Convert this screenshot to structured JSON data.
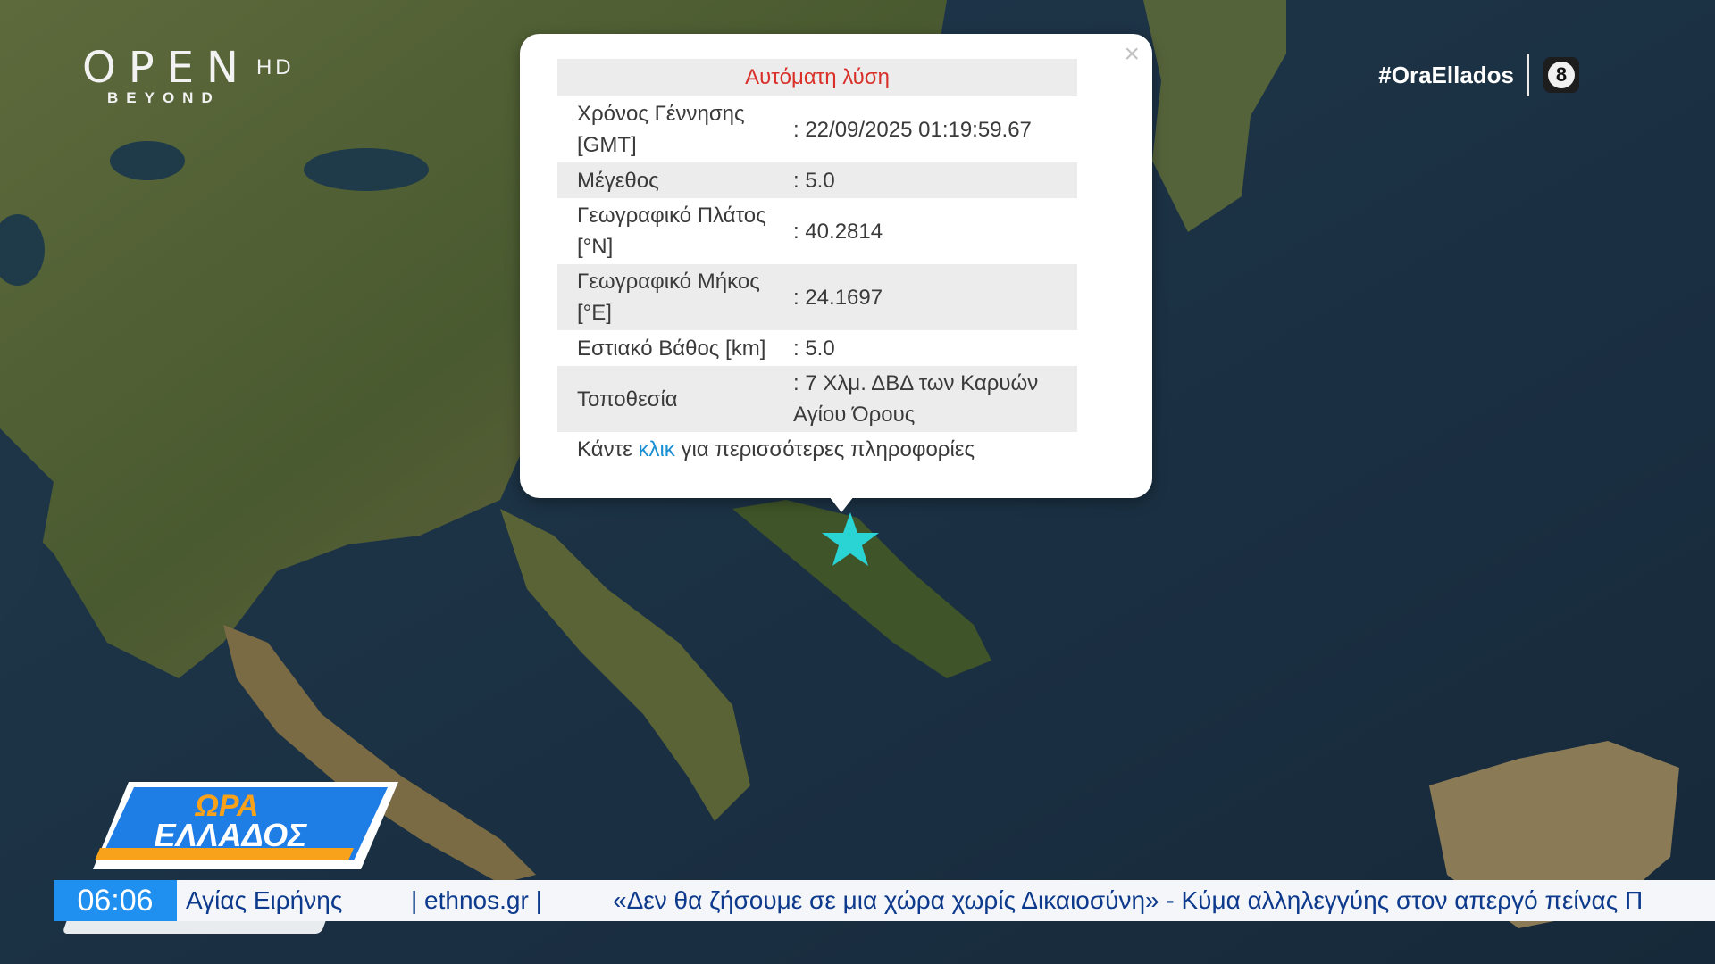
{
  "channel": {
    "name": "OPEN",
    "quality": "HD",
    "tagline": "BEYOND"
  },
  "hashtag": "#OraEllados",
  "rating": "8",
  "popup": {
    "title": "Αυτόματη λύση",
    "close_label": "×",
    "rows": [
      {
        "label": "Χρόνος Γέννησης [GMT]",
        "value": ": 22/09/2025 01:19:59.67"
      },
      {
        "label": "Μέγεθος",
        "value": ": 5.0"
      },
      {
        "label": "Γεωγραφικό Πλάτος [°N]",
        "value": ": 40.2814"
      },
      {
        "label": "Γεωγραφικό Μήκος [°E]",
        "value": ": 24.1697"
      },
      {
        "label": "Εστιακό Βάθος [km]",
        "value": ": 5.0"
      },
      {
        "label": "Τοποθεσία",
        "value": ": 7 Χλμ. ΔΒΔ των Καρυών Αγίου Όρους"
      }
    ],
    "footer_prefix": "Κάντε",
    "footer_link": "κλικ",
    "footer_suffix": "για περισσότερες πληροφορίες"
  },
  "map": {
    "marker_icon": "star-icon",
    "marker_color": "#2ad4d4"
  },
  "show": {
    "line1": "ΩΡΑ",
    "line2": "ΕΛΛΑΔΟΣ"
  },
  "ticker": {
    "time": "06:06",
    "nameday": "Αγίας Ειρήνης",
    "source": "| ethnos.gr |",
    "headline": "«Δεν θα ζήσουμε σε μια χώρα χωρίς Δικαιοσύνη» - Κύμα αλληλεγγύης στον απεργό πείνας Π"
  }
}
